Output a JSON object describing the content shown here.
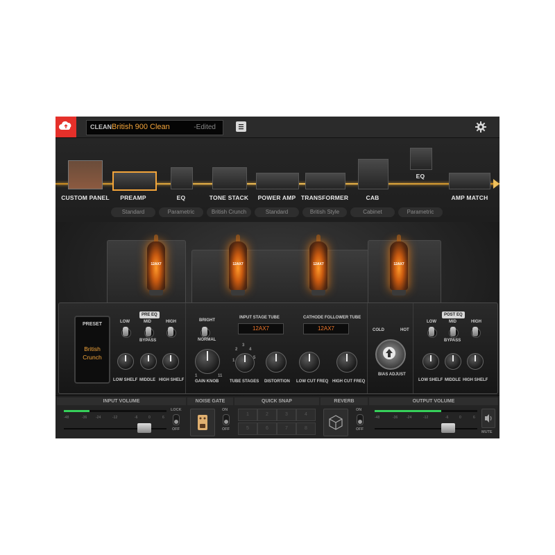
{
  "topbar": {
    "preset_type": "CLEAN",
    "preset_name": "British 900 Clean",
    "preset_status": "-Edited",
    "icons": [
      "cloud-icon",
      "menu-icon",
      "gear-icon"
    ]
  },
  "chain": [
    {
      "label": "CUSTOM PANEL",
      "sub": ""
    },
    {
      "label": "PREAMP",
      "sub": "Standard"
    },
    {
      "label": "EQ",
      "sub": "Parametric"
    },
    {
      "label": "TONE STACK",
      "sub": "British Crunch"
    },
    {
      "label": "POWER AMP",
      "sub": "Standard"
    },
    {
      "label": "TRANSFORMER",
      "sub": "British Style"
    },
    {
      "label": "CAB",
      "sub": "Cabinet"
    },
    {
      "label": "EQ",
      "sub": "Parametric"
    },
    {
      "label": "AMP MATCH",
      "sub": ""
    }
  ],
  "tubes": [
    {
      "label": "12AX7"
    },
    {
      "label": "12AX7"
    },
    {
      "label": "12AX7"
    },
    {
      "label": "12AX7"
    }
  ],
  "amp": {
    "preset_title": "PRESET",
    "preset_value": "British Crunch",
    "pre_eq": {
      "badge": "PRE EQ",
      "toggles": [
        "LOW",
        "MID",
        "HIGH"
      ],
      "bypass": "BYPASS",
      "knobs": [
        "LOW SHELF",
        "MIDDLE",
        "HIGH SHELF"
      ]
    },
    "bright": {
      "label": "BRIGHT",
      "sub": "NORMAL"
    },
    "input_stage_tube": {
      "label": "INPUT STAGE TUBE",
      "value": "12AX7"
    },
    "cathode_tube": {
      "label": "CATHODE FOLLOWER TUBE",
      "value": "12AX7"
    },
    "main_knobs": [
      "GAIN KNOB",
      "TUBE STAGES",
      "DISTORTION",
      "LOW CUT FREQ",
      "HIGH CUT FREQ"
    ],
    "gain_scale": {
      "min": "1",
      "max": "11"
    },
    "stage_scale": [
      "1",
      "2",
      "3",
      "4",
      "5"
    ],
    "bias": {
      "cold": "COLD",
      "hot": "HOT",
      "label": "BIAS ADJUST"
    },
    "post_eq": {
      "badge": "POST EQ",
      "toggles": [
        "LOW",
        "MID",
        "HIGH"
      ],
      "bypass": "BYPASS",
      "knobs": [
        "LOW SHELF",
        "MIDDLE",
        "HIGH SHELF"
      ]
    }
  },
  "bottom": {
    "input_volume": {
      "title": "INPUT VOLUME",
      "scale": [
        "-48",
        "-36",
        "-24",
        "-12",
        "-6",
        "0",
        "6"
      ],
      "lock_on": "LOCK",
      "lock_off": "OFF",
      "level": 0.25
    },
    "noise_gate": {
      "title": "NOISE GATE",
      "on": "ON",
      "off": "OFF"
    },
    "quick_snap": {
      "title": "QUICK SNAP",
      "slots": [
        "1",
        "2",
        "3",
        "4",
        "5",
        "6",
        "7",
        "8"
      ]
    },
    "reverb": {
      "title": "REVERB",
      "on": "ON",
      "off": "OFF"
    },
    "output_volume": {
      "title": "OUTPUT VOLUME",
      "scale": [
        "-48",
        "-36",
        "-24",
        "-12",
        "-6",
        "0",
        "6"
      ],
      "mute": "MUTE",
      "level": 0.65
    }
  },
  "colors": {
    "accent": "#e5302a",
    "preset_name": "#f4a53a",
    "display_text": "#f0772a",
    "meter": "#36d05a",
    "chain_line": "#f1c15a"
  }
}
